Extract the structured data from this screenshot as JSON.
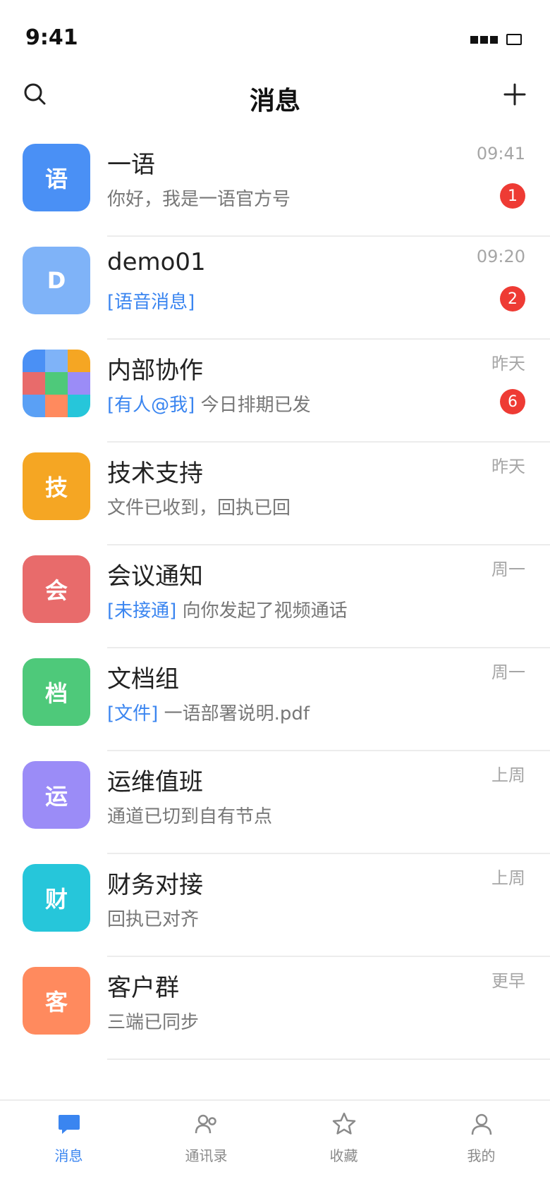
{
  "status_bar": {
    "time": "9:41"
  },
  "header": {
    "title": "消息"
  },
  "colors": {
    "accent": "#3a85f0",
    "badge": "#ee3b34",
    "muted": "#a6a6a6"
  },
  "conversations": [
    {
      "avatar_text": "语",
      "avatar_color": "#4a90f5",
      "name": "一语",
      "time": "09:41",
      "preview_tag": "",
      "preview": "你好，我是一语官方号",
      "badge": "1"
    },
    {
      "avatar_text": "D",
      "avatar_color": "#7fb3f8",
      "name": "demo01",
      "time": "09:20",
      "preview_tag": "[语音消息]",
      "preview": "",
      "badge": "2"
    },
    {
      "avatar_text": "",
      "avatar_icon": "group-mosaic",
      "avatar_tiles": [
        "#4a90f5",
        "#7fb3f8",
        "#f5a623",
        "#e86b6b",
        "#4ec97a",
        "#9b8cf7",
        "#5aa0f5",
        "#ff8a5e",
        "#26c6da"
      ],
      "name": "内部协作",
      "time": "昨天",
      "preview_tag": "[有人@我]",
      "preview": "今日排期已发",
      "badge": "6"
    },
    {
      "avatar_text": "技",
      "avatar_color": "#f5a623",
      "name": "技术支持",
      "time": "昨天",
      "preview_tag": "",
      "preview": "文件已收到，回执已回",
      "badge": ""
    },
    {
      "avatar_text": "会",
      "avatar_color": "#e86b6b",
      "name": "会议通知",
      "time": "周一",
      "preview_tag": "[未接通]",
      "preview": "向你发起了视频通话",
      "badge": ""
    },
    {
      "avatar_text": "档",
      "avatar_color": "#4ec97a",
      "name": "文档组",
      "time": "周一",
      "preview_tag": "[文件]",
      "preview": "一语部署说明.pdf",
      "badge": ""
    },
    {
      "avatar_text": "运",
      "avatar_color": "#9b8cf7",
      "name": "运维值班",
      "time": "上周",
      "preview_tag": "",
      "preview": "通道已切到自有节点",
      "badge": ""
    },
    {
      "avatar_text": "财",
      "avatar_color": "#26c6da",
      "name": "财务对接",
      "time": "上周",
      "preview_tag": "",
      "preview": "回执已对齐",
      "badge": ""
    },
    {
      "avatar_text": "客",
      "avatar_color": "#ff8a5e",
      "name": "客户群",
      "time": "更早",
      "preview_tag": "",
      "preview": "三端已同步",
      "badge": ""
    }
  ],
  "tabs": [
    {
      "label": "消息",
      "icon": "chat-bubble-icon",
      "active": true
    },
    {
      "label": "通讯录",
      "icon": "contacts-icon",
      "active": false
    },
    {
      "label": "收藏",
      "icon": "star-icon",
      "active": false
    },
    {
      "label": "我的",
      "icon": "user-icon",
      "active": false
    }
  ]
}
